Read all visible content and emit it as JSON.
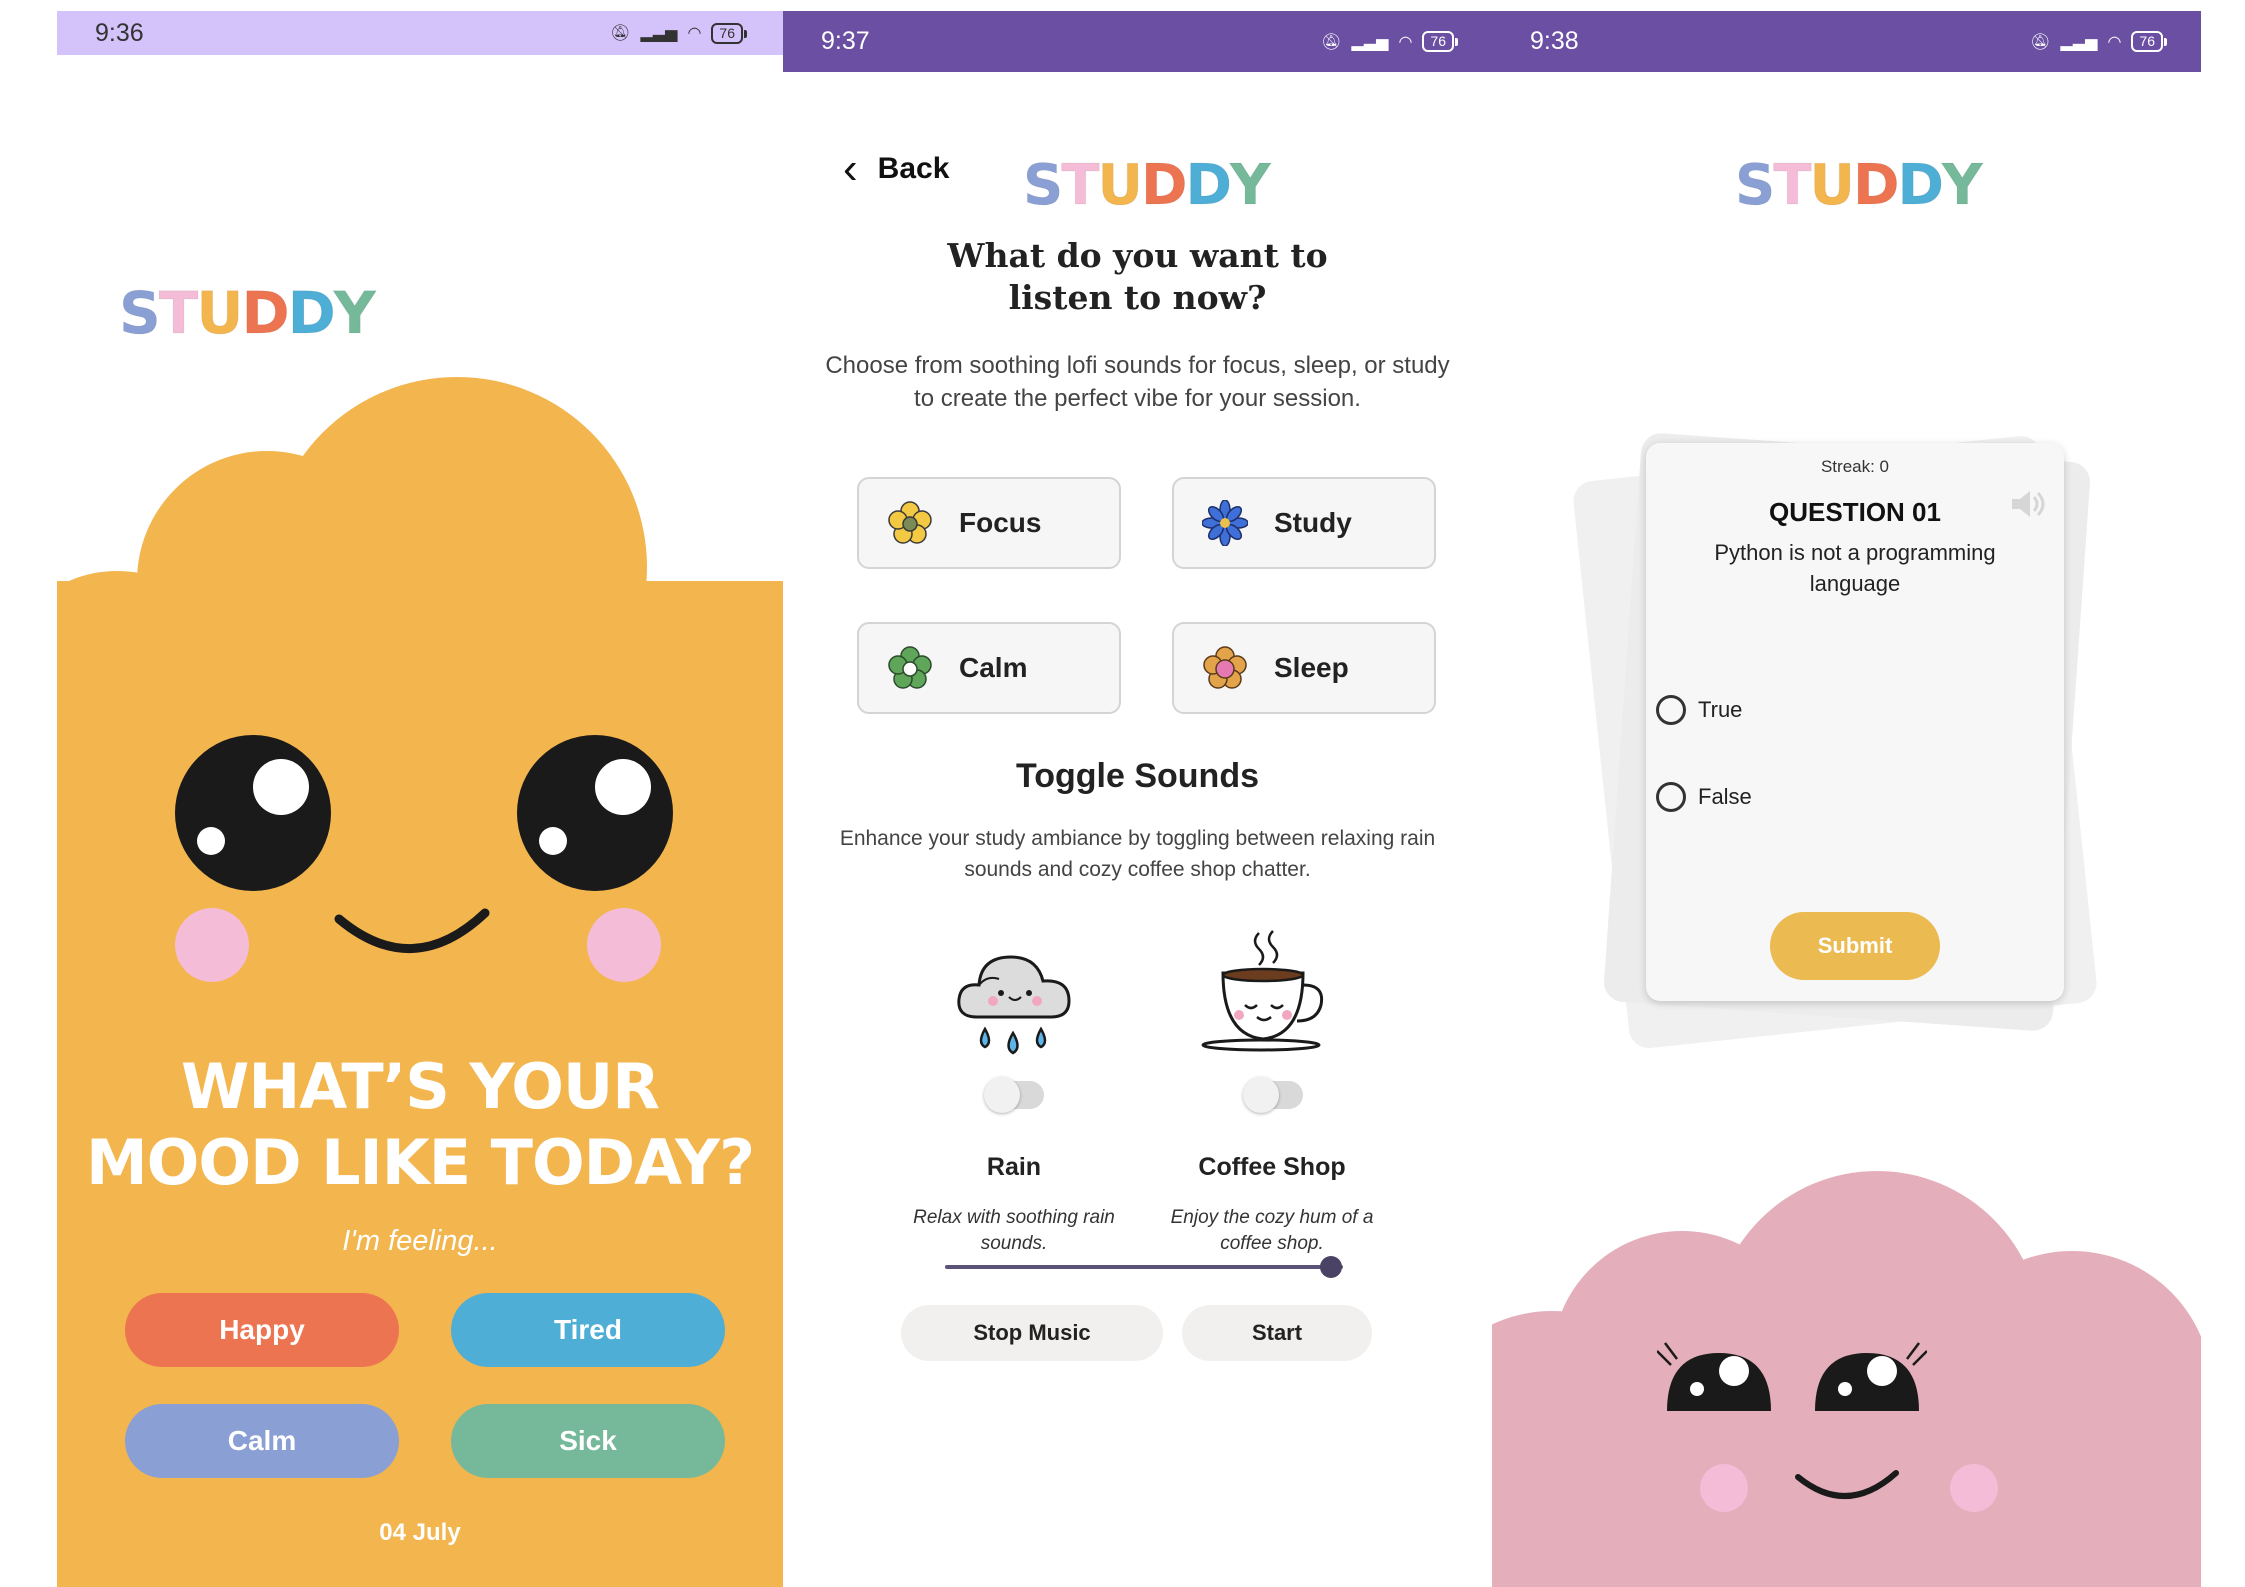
{
  "screen1": {
    "status": {
      "time": "9:36",
      "battery": "76"
    },
    "logo": [
      "S",
      "T",
      "U",
      "D",
      "D",
      "Y"
    ],
    "title_line1": "WHAT’S YOUR",
    "title_line2": "MOOD LIKE TODAY?",
    "subtitle": "I'm feeling...",
    "moods": [
      {
        "label": "Happy",
        "color": "#ec7451"
      },
      {
        "label": "Tired",
        "color": "#4eaed6"
      },
      {
        "label": "Calm",
        "color": "#8a9fd3"
      },
      {
        "label": "Sick",
        "color": "#76b99a"
      }
    ],
    "date": "04 July",
    "background_color": "#f3b54d"
  },
  "screen2": {
    "status": {
      "time": "9:37",
      "battery": "76"
    },
    "back_label": "Back",
    "logo": [
      "S",
      "T",
      "U",
      "D",
      "D",
      "Y"
    ],
    "title": "What do you want to listen to now?",
    "description": "Choose from soothing lofi sounds for focus, sleep, or study to create the perfect vibe for your session.",
    "categories": [
      {
        "label": "Focus",
        "icon": "yellow-flower-icon"
      },
      {
        "label": "Study",
        "icon": "blue-flower-icon"
      },
      {
        "label": "Calm",
        "icon": "green-flower-icon"
      },
      {
        "label": "Sleep",
        "icon": "pink-flower-icon"
      }
    ],
    "toggle_title": "Toggle Sounds",
    "toggle_description": "Enhance your study ambiance by toggling between relaxing rain sounds and cozy coffee shop chatter.",
    "ambients": [
      {
        "label": "Rain",
        "description": "Relax with soothing rain sounds.",
        "icon": "rain-cloud-icon",
        "enabled": false
      },
      {
        "label": "Coffee Shop",
        "description": "Enjoy the cozy hum of a coffee shop.",
        "icon": "coffee-cup-icon",
        "enabled": false
      }
    ],
    "volume_fraction": 0.97,
    "stop_label": "Stop Music",
    "start_label": "Start"
  },
  "screen3": {
    "status": {
      "time": "9:38",
      "battery": "76"
    },
    "logo": [
      "S",
      "T",
      "U",
      "D",
      "D",
      "Y"
    ],
    "streak": "Streak: 0",
    "question_number": "QUESTION 01",
    "question_text": "Python is not a programming language",
    "options": [
      "True",
      "False"
    ],
    "submit_label": "Submit",
    "mascot_color": "#e4aebb"
  },
  "logo_colors": [
    "#8a9fd3",
    "#f4bcd6",
    "#f3b54d",
    "#ec7451",
    "#4eaed6",
    "#76b99a"
  ]
}
